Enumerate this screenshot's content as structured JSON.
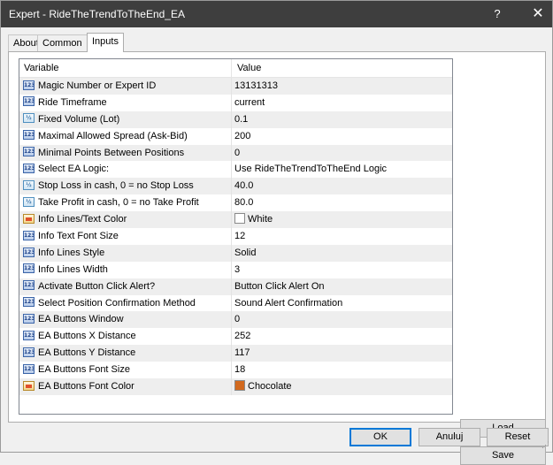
{
  "window": {
    "title": "Expert - RideTheTrendToTheEnd_EA",
    "help_label": "?",
    "close_label": "✕"
  },
  "tabs": [
    {
      "label": "About"
    },
    {
      "label": "Common"
    },
    {
      "label": "Inputs",
      "active": true
    }
  ],
  "grid": {
    "header_variable": "Variable",
    "header_value": "Value",
    "rows": [
      {
        "variable": "Magic Number or Expert ID",
        "value": "13131313",
        "icon": "int-icon"
      },
      {
        "variable": "Ride Timeframe",
        "value": "current",
        "icon": "int-icon"
      },
      {
        "variable": "Fixed Volume (Lot)",
        "value": "0.1",
        "icon": "double-icon"
      },
      {
        "variable": "Maximal Allowed Spread (Ask-Bid)",
        "value": "200",
        "icon": "int-icon"
      },
      {
        "variable": "Minimal Points Between Positions",
        "value": "0",
        "icon": "int-icon"
      },
      {
        "variable": "Select EA Logic:",
        "value": "Use RideTheTrendToTheEnd Logic",
        "icon": "int-icon"
      },
      {
        "variable": "Stop Loss in cash, 0 = no Stop Loss",
        "value": "40.0",
        "icon": "double-icon"
      },
      {
        "variable": "Take Profit in cash, 0 = no Take Profit",
        "value": "80.0",
        "icon": "double-icon"
      },
      {
        "variable": "Info Lines/Text Color",
        "value": "White",
        "icon": "color-icon",
        "swatch": "#ffffff"
      },
      {
        "variable": "Info Text Font Size",
        "value": "12",
        "icon": "int-icon"
      },
      {
        "variable": "Info Lines Style",
        "value": "Solid",
        "icon": "int-icon"
      },
      {
        "variable": "Info Lines Width",
        "value": "3",
        "icon": "int-icon"
      },
      {
        "variable": "Activate Button Click Alert?",
        "value": "Button Click Alert On",
        "icon": "int-icon"
      },
      {
        "variable": "Select Position Confirmation Method",
        "value": "Sound Alert Confirmation",
        "icon": "int-icon"
      },
      {
        "variable": "EA Buttons Window",
        "value": "0",
        "icon": "int-icon"
      },
      {
        "variable": "EA Buttons X Distance",
        "value": "252",
        "icon": "int-icon"
      },
      {
        "variable": "EA Buttons Y Distance",
        "value": "117",
        "icon": "int-icon"
      },
      {
        "variable": "EA Buttons Font Size",
        "value": "18",
        "icon": "int-icon"
      },
      {
        "variable": "EA Buttons Font Color",
        "value": "Chocolate",
        "icon": "color-icon",
        "swatch": "#d2691e"
      }
    ]
  },
  "buttons": {
    "load": "Load",
    "save": "Save",
    "ok": "OK",
    "cancel": "Anuluj",
    "reset": "Reset"
  },
  "colors": {
    "titlebar": "#3e3e3e",
    "ok_border": "#0078d7"
  }
}
